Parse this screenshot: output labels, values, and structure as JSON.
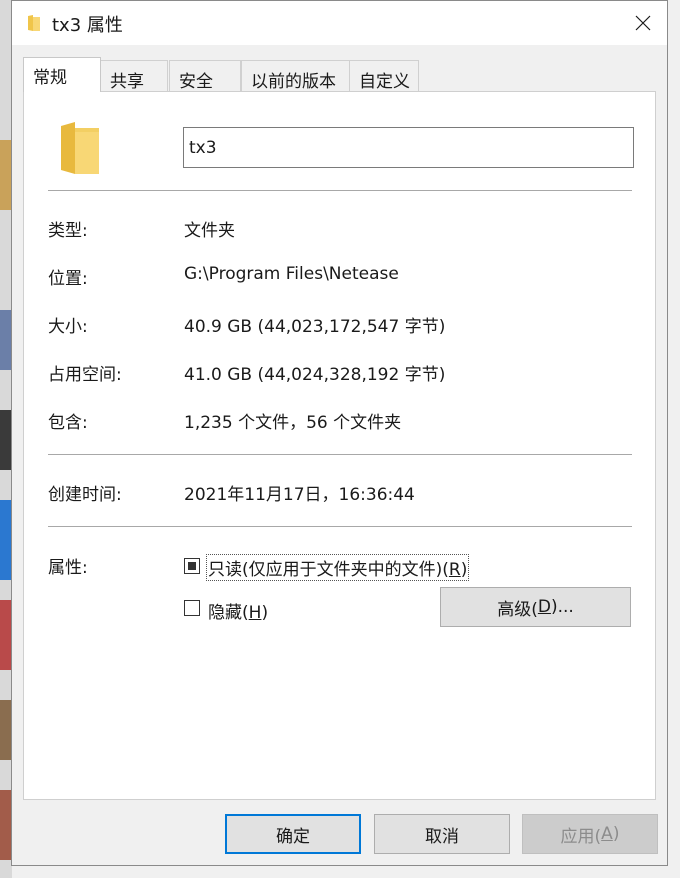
{
  "window": {
    "title": "tx3 属性",
    "close_icon": "close-icon"
  },
  "tabs": [
    {
      "label": "常规",
      "active": true
    },
    {
      "label": "共享"
    },
    {
      "label": "安全"
    },
    {
      "label": "以前的版本"
    },
    {
      "label": "自定义"
    }
  ],
  "general": {
    "folder_name": "tx3",
    "type_label": "类型:",
    "type_value": "文件夹",
    "location_label": "位置:",
    "location_value": "G:\\Program Files\\Netease",
    "size_label": "大小:",
    "size_value": "40.9 GB (44,023,172,547 字节)",
    "disk_size_label": "占用空间:",
    "disk_size_value": "41.0 GB (44,024,328,192 字节)",
    "contains_label": "包含:",
    "contains_value": "1,235 个文件，56 个文件夹",
    "created_label": "创建时间:",
    "created_value": "2021年11月17日，16:36:44",
    "attributes_label": "属性:",
    "readonly": {
      "label_pre": "只读(仅应用于文件夹中的文件)(",
      "accel": "R",
      "label_post": ")",
      "state": "indeterminate"
    },
    "hidden": {
      "label_pre": "隐藏(",
      "accel": "H",
      "label_post": ")",
      "checked": false
    },
    "advanced": {
      "label_pre": "高级(",
      "accel": "D",
      "label_post": ")..."
    }
  },
  "footer": {
    "ok": "确定",
    "cancel": "取消",
    "apply": {
      "label_pre": "应用(",
      "accel": "A",
      "label_post": ")"
    }
  },
  "colors": {
    "accent": "#0078d7",
    "folder": "#f8d775"
  }
}
